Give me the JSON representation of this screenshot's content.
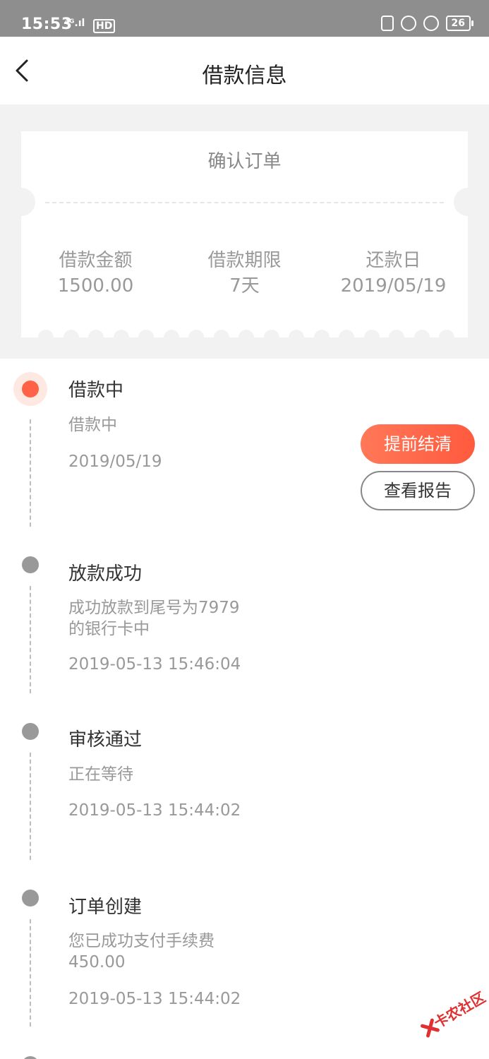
{
  "status_bar": {
    "time": "15:53",
    "signal": "⁴ᴳ.ıl",
    "network": "HD",
    "battery": "26"
  },
  "header": {
    "title": "借款信息"
  },
  "ticket": {
    "title": "确认订单",
    "items": [
      {
        "label": "借款金额",
        "value": "1500.00"
      },
      {
        "label": "借款期限",
        "value": "7天"
      },
      {
        "label": "还款日",
        "value": "2019/05/19"
      }
    ]
  },
  "timeline": [
    {
      "title": "借款中",
      "desc": "借款中",
      "time": "2019/05/19",
      "active": true
    },
    {
      "title": "放款成功",
      "desc": "成功放款到尾号为7979的银行卡中",
      "time": "2019-05-13 15:46:04",
      "active": false
    },
    {
      "title": "审核通过",
      "desc": "正在等待",
      "time": "2019-05-13 15:44:02",
      "active": false
    },
    {
      "title": "订单创建",
      "desc": "您已成功支付手续费450.00",
      "time": "2019-05-13 15:44:02",
      "active": false
    }
  ],
  "actions": {
    "settle_label": "提前结清",
    "report_label": "查看报告"
  },
  "colors": {
    "accent": "#ff6247",
    "accent_light": "#fde9e1",
    "inactive_dot": "#999999",
    "background_gray": "#f2f2f2"
  },
  "watermark": {
    "text": "卡农社区"
  }
}
